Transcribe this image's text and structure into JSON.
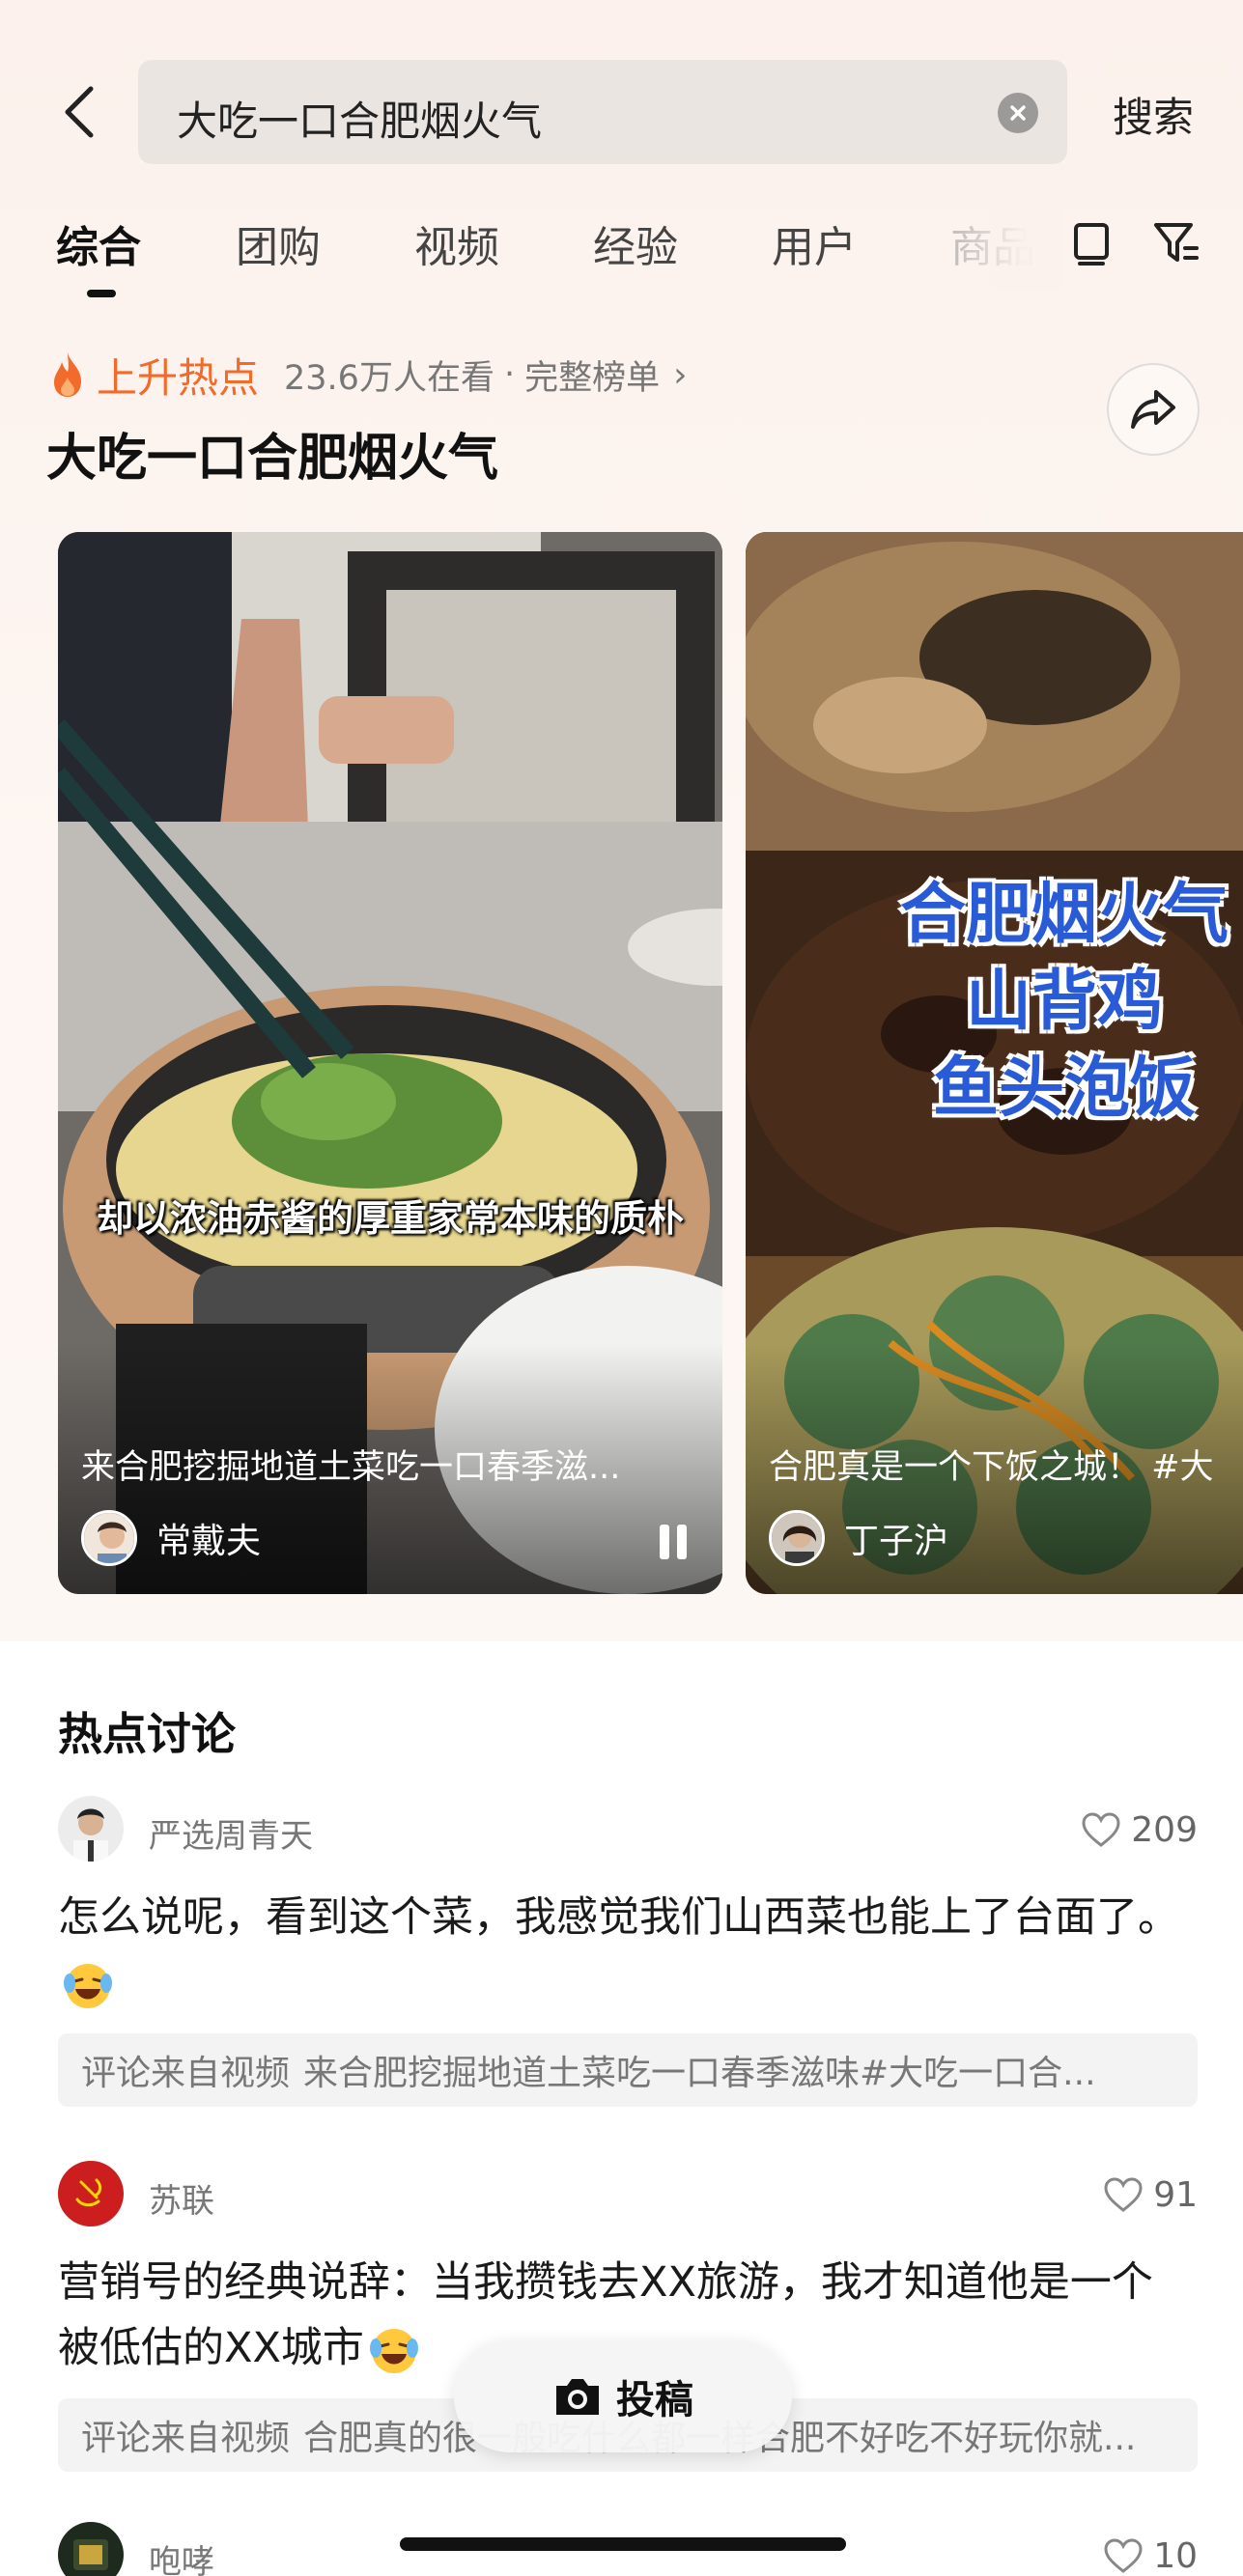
{
  "search": {
    "query": "大吃一口合肥烟火气",
    "search_label": "搜索"
  },
  "tabs": [
    {
      "label": "综合",
      "active": true
    },
    {
      "label": "团购"
    },
    {
      "label": "视频"
    },
    {
      "label": "经验"
    },
    {
      "label": "用户"
    },
    {
      "label": "商品"
    }
  ],
  "hot": {
    "label": "上升热点",
    "viewers": "23.6万人在看",
    "separator": "·",
    "full_list": "完整榜单",
    "title": "大吃一口合肥烟火气"
  },
  "videos": [
    {
      "caption": "来合肥挖掘地道土菜吃一口春季滋...",
      "author": "常戴夫",
      "overlay_text": "却以浓油赤酱的厚重家常本味的质朴"
    },
    {
      "caption": "合肥真是一个下饭之城！ #大",
      "author": "丁子沪",
      "overlay_lines": [
        "合肥烟火气",
        "山背鸡",
        "鱼头泡饭"
      ]
    }
  ],
  "discussion": {
    "title": "热点讨论",
    "source_prefix": "评论来自视频",
    "comments": [
      {
        "user": "严选周青天",
        "likes": "209",
        "text": "怎么说呢，看到这个菜，我感觉我们山西菜也能上了台面了。",
        "emoji": "laughing-crying",
        "source": "来合肥挖掘地道土菜吃一口春季滋味#大吃一口合..."
      },
      {
        "user": "苏联",
        "likes": "91",
        "text": "营销号的经典说辞：当我攒钱去XX旅游，我才知道他是一个被低估的XX城市",
        "emoji": "laughing-crying",
        "source": "合肥真的很一般吃什么都一样合肥不好吃不好玩你就..."
      },
      {
        "user": "咆哮",
        "likes": "10"
      }
    ]
  },
  "post_button": {
    "label": "投稿"
  },
  "colors": {
    "accent": "#f26b2a",
    "background": "#fdf4f0"
  }
}
